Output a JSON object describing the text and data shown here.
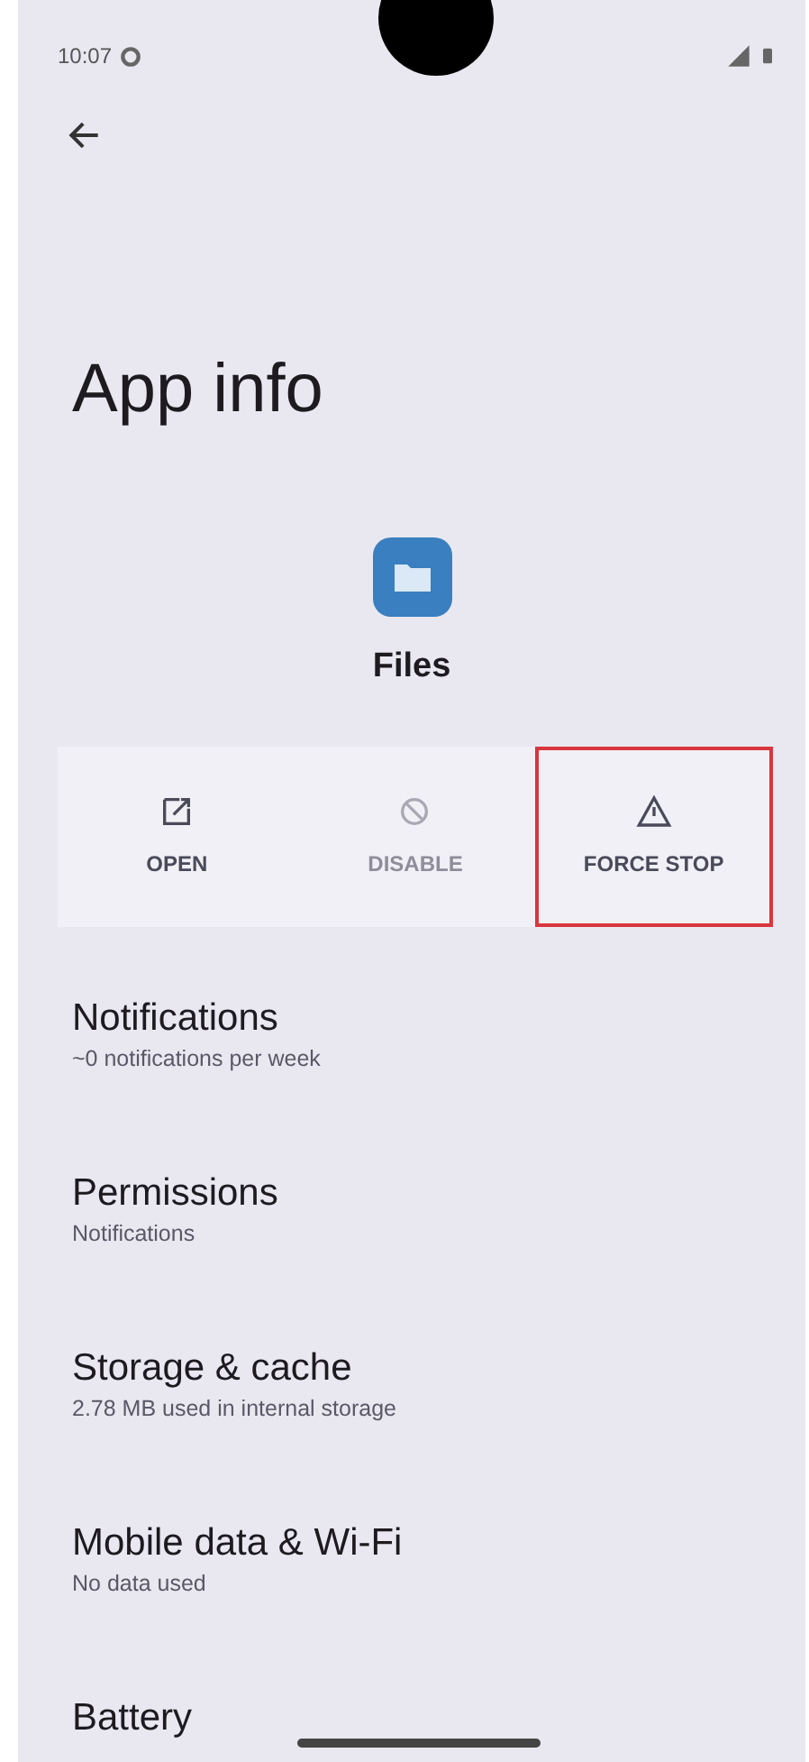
{
  "status_bar": {
    "time": "10:07"
  },
  "title": "App info",
  "app": {
    "name": "Files"
  },
  "actions": [
    {
      "kind": "open",
      "label": "OPEN",
      "disabled": false,
      "highlighted": false
    },
    {
      "kind": "disable",
      "label": "DISABLE",
      "disabled": true,
      "highlighted": false
    },
    {
      "kind": "stop",
      "label": "FORCE STOP",
      "disabled": false,
      "highlighted": true
    }
  ],
  "settings": [
    {
      "title": "Notifications",
      "summary": "~0 notifications per week"
    },
    {
      "title": "Permissions",
      "summary": "Notifications"
    },
    {
      "title": "Storage & cache",
      "summary": "2.78 MB used in internal storage"
    },
    {
      "title": "Mobile data & Wi-Fi",
      "summary": "No data used"
    },
    {
      "title": "Battery"
    }
  ]
}
